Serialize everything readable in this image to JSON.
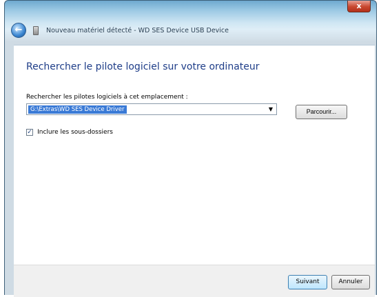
{
  "window": {
    "title": "Nouveau matériel détecté - WD SES Device USB Device",
    "close_label": "x"
  },
  "main": {
    "heading": "Rechercher le pilote logiciel sur votre ordinateur",
    "location_label": "Rechercher les pilotes logiciels à cet emplacement :",
    "path_value": "G:\\Extras\\WD SES Device Driver",
    "browse_label": "Parcourir...",
    "include_subfolders_label": "Inclure les sous-dossiers",
    "include_subfolders_checked": true
  },
  "footer": {
    "next_label": "Suivant",
    "cancel_label": "Annuler"
  },
  "colors": {
    "heading": "#1e3d88",
    "selection": "#3a7ad6",
    "close": "#c8472f"
  },
  "icons": {
    "back": "back-arrow-icon",
    "device": "device-icon",
    "close": "close-icon",
    "dropdown": "chevron-down-icon",
    "checkmark": "checkmark-icon"
  }
}
